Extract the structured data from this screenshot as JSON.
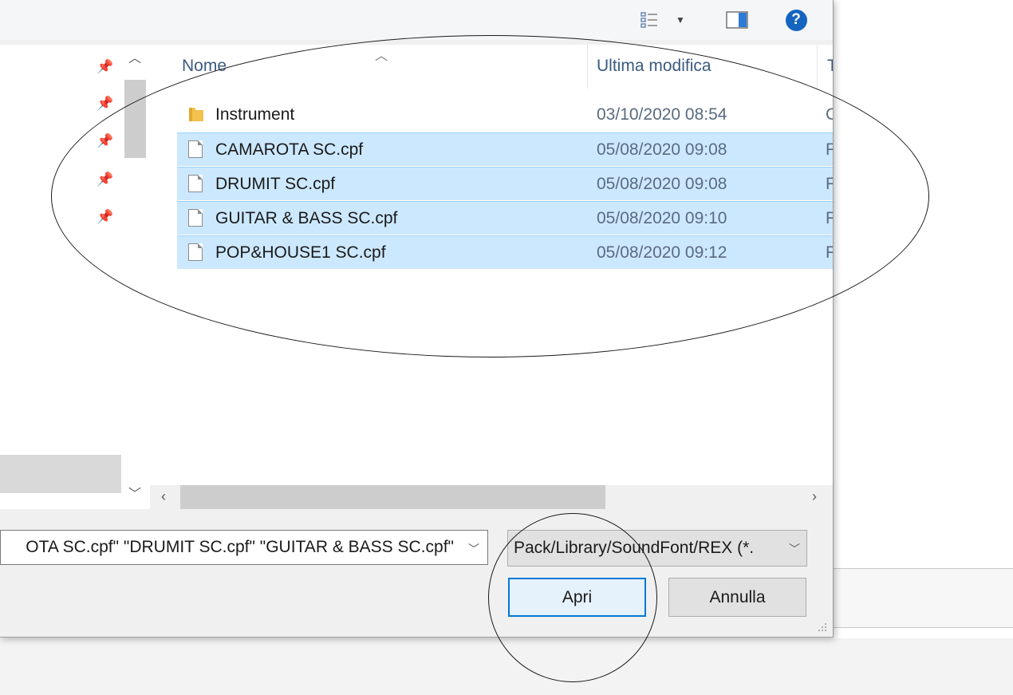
{
  "toolbar": {
    "view_icon": "details-view-icon",
    "view_dropdown_icon": "dropdown-triangle-icon",
    "preview_icon": "preview-pane-icon",
    "help_label": "?"
  },
  "file_list": {
    "columns": {
      "name": "Nome",
      "modified": "Ultima modifica",
      "type_partial": "T"
    },
    "rows": [
      {
        "name": "Instrument",
        "modified": "03/10/2020 08:54",
        "type_partial": "C",
        "icon": "folder-icon",
        "selected": false
      },
      {
        "name": "CAMAROTA SC.cpf",
        "modified": "05/08/2020 09:08",
        "type_partial": "F",
        "icon": "file-icon",
        "selected": true
      },
      {
        "name": "DRUMIT SC.cpf",
        "modified": "05/08/2020 09:08",
        "type_partial": "F",
        "icon": "file-icon",
        "selected": true
      },
      {
        "name": "GUITAR & BASS SC.cpf",
        "modified": "05/08/2020 09:10",
        "type_partial": "F",
        "icon": "file-icon",
        "selected": true
      },
      {
        "name": "POP&HOUSE1 SC.cpf",
        "modified": "05/08/2020 09:12",
        "type_partial": "F",
        "icon": "file-icon",
        "selected": true
      }
    ]
  },
  "bottom": {
    "file_name_value": "OTA SC.cpf\" \"DRUMIT SC.cpf\" \"GUITAR & BASS SC.cpf\"",
    "file_type_value": "Pack/Library/SoundFont/REX (*.",
    "open_label": "Apri",
    "cancel_label": "Annulla"
  },
  "colors": {
    "selection_bg": "#cce8ff",
    "accent": "#0078d7",
    "help_blue": "#1565c0"
  }
}
